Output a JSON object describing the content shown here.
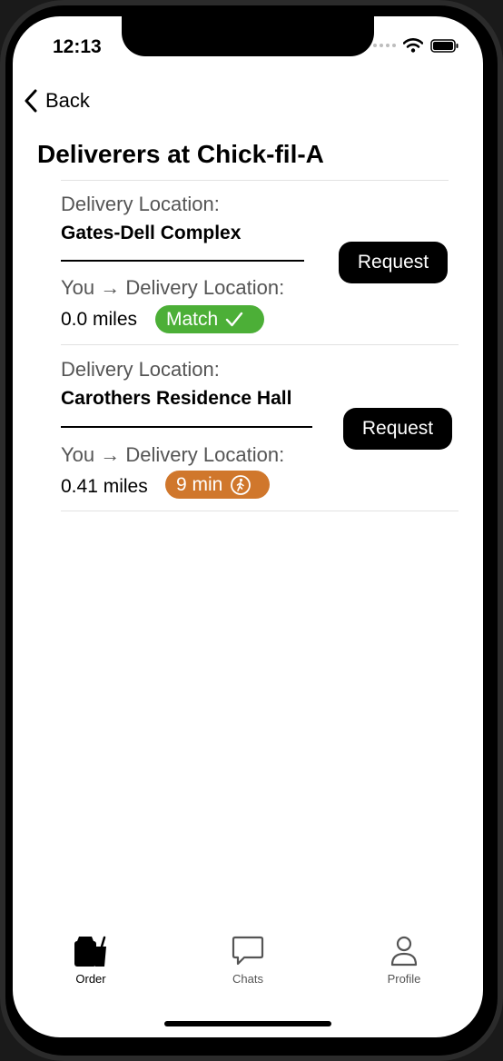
{
  "status_bar": {
    "time": "12:13"
  },
  "nav": {
    "back_label": "Back"
  },
  "page": {
    "title": "Deliverers at Chick-fil-A"
  },
  "deliverers": [
    {
      "location_label": "Delivery Location:",
      "location_name": "Gates-Dell Complex",
      "route_label": "You → Delivery Location:",
      "distance": "0.0 miles",
      "badge_text": "Match",
      "badge_icon": "checkmark-icon",
      "badge_color": "#4caf37",
      "request_label": "Request"
    },
    {
      "location_label": "Delivery Location:",
      "location_name": "Carothers Residence Hall",
      "route_label": "You → Delivery Location:",
      "distance": "0.41 miles",
      "badge_text": "9 min",
      "badge_icon": "walking-icon",
      "badge_color": "#d0772c",
      "request_label": "Request"
    }
  ],
  "tab_bar": {
    "tabs": [
      {
        "label": "Order",
        "icon": "bag-icon",
        "active": true
      },
      {
        "label": "Chats",
        "icon": "chat-bubble-icon",
        "active": false
      },
      {
        "label": "Profile",
        "icon": "person-icon",
        "active": false
      }
    ]
  }
}
